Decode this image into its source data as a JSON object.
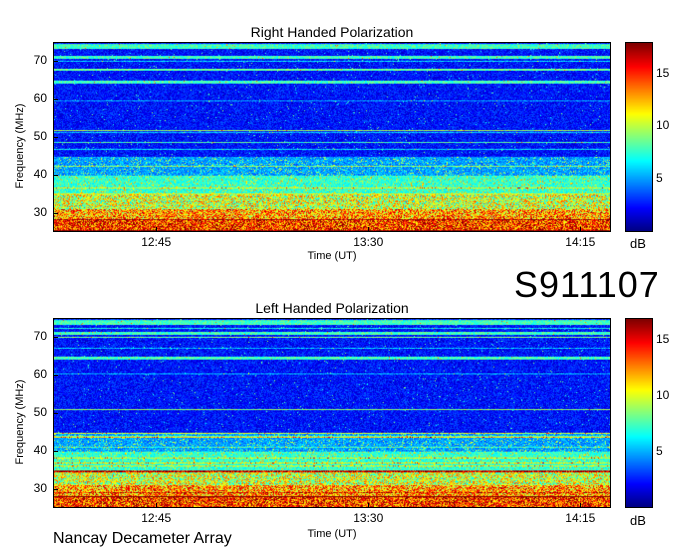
{
  "identifier": "S911107",
  "footer": "Nancay Decameter Array",
  "chart_data": [
    {
      "type": "heatmap",
      "title": "Right Handed Polarization",
      "xlabel": "Time (UT)",
      "ylabel": "Frequency (MHz)",
      "xticks": [
        "12:45",
        "13:30",
        "14:15"
      ],
      "yticks": [
        30,
        40,
        50,
        60,
        70
      ],
      "ylim": [
        25,
        75
      ],
      "colorbar": {
        "ticks": [
          5,
          10,
          15
        ],
        "range": [
          0,
          18
        ],
        "unit": "dB",
        "colormap": "jet"
      },
      "description_of_values": "intensity high (~15-18 dB) below 30 MHz, mixed 30-45 MHz, low (~0-3 dB) above 45 MHz with narrow interference lines"
    },
    {
      "type": "heatmap",
      "title": "Left Handed Polarization",
      "xlabel": "Time (UT)",
      "ylabel": "Frequency (MHz)",
      "xticks": [
        "12:45",
        "13:30",
        "14:15"
      ],
      "yticks": [
        30,
        40,
        50,
        60,
        70
      ],
      "ylim": [
        25,
        75
      ],
      "colorbar": {
        "ticks": [
          5,
          10,
          15
        ],
        "range": [
          0,
          17
        ],
        "unit": "dB",
        "colormap": "jet"
      }
    }
  ]
}
